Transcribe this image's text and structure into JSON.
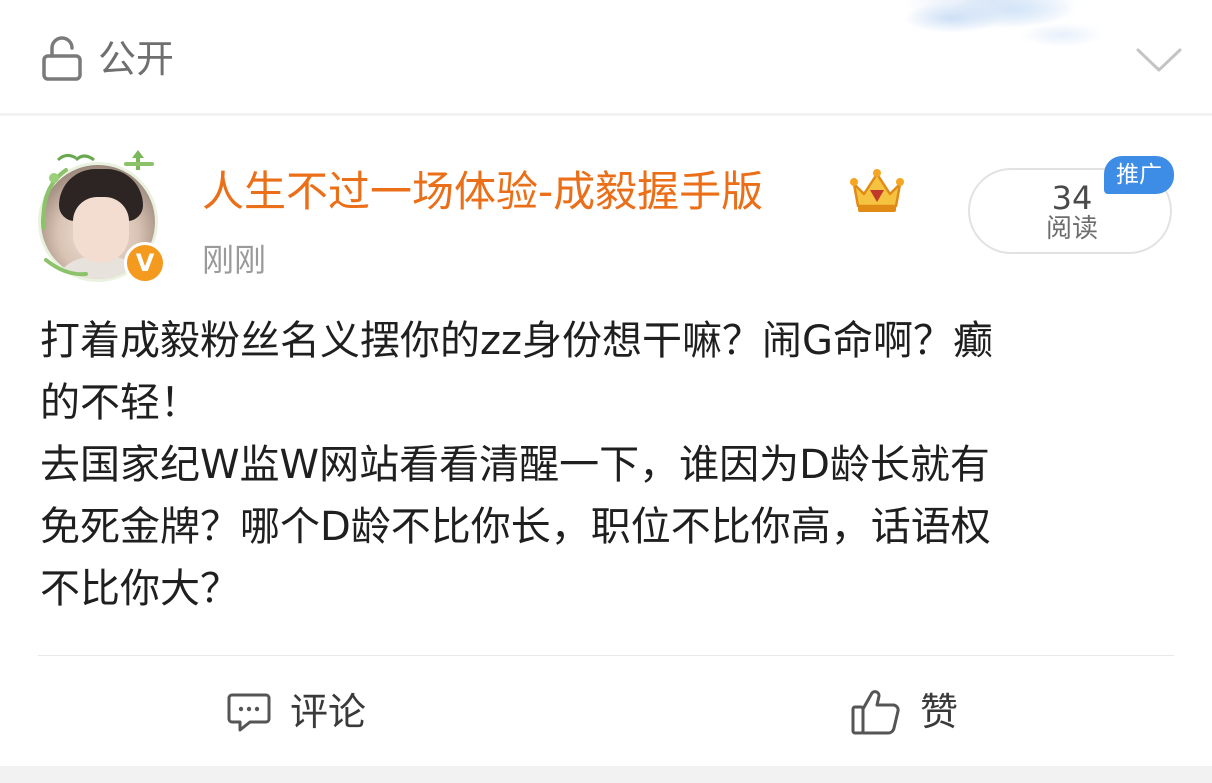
{
  "visibility": {
    "icon": "lock-icon",
    "label": "公开",
    "expand_icon": "chevron-down-icon"
  },
  "post": {
    "author": {
      "name": "人生不过一场体验-成毅握手版",
      "name_color": "#eb6f18",
      "verified_badge": "V",
      "verified_color": "#f39a1f",
      "vip_icon": "crown-icon"
    },
    "time": "刚刚",
    "reads": {
      "count": "34",
      "label": "阅读"
    },
    "promo_badge": "推广",
    "promo_color": "#3d8de6",
    "text_lines": [
      "打着成毅粉丝名义摆你的zz身份想干嘛？闹G命啊？癫",
      "的不轻！",
      "去国家纪W监W网站看看清醒一下，谁因为D龄长就有",
      "免死金牌？哪个D龄不比你长，职位不比你高，话语权",
      "不比你大？"
    ]
  },
  "actions": {
    "comment": {
      "icon": "comment-icon",
      "label": "评论"
    },
    "like": {
      "icon": "thumbs-up-icon",
      "label": "赞"
    }
  }
}
